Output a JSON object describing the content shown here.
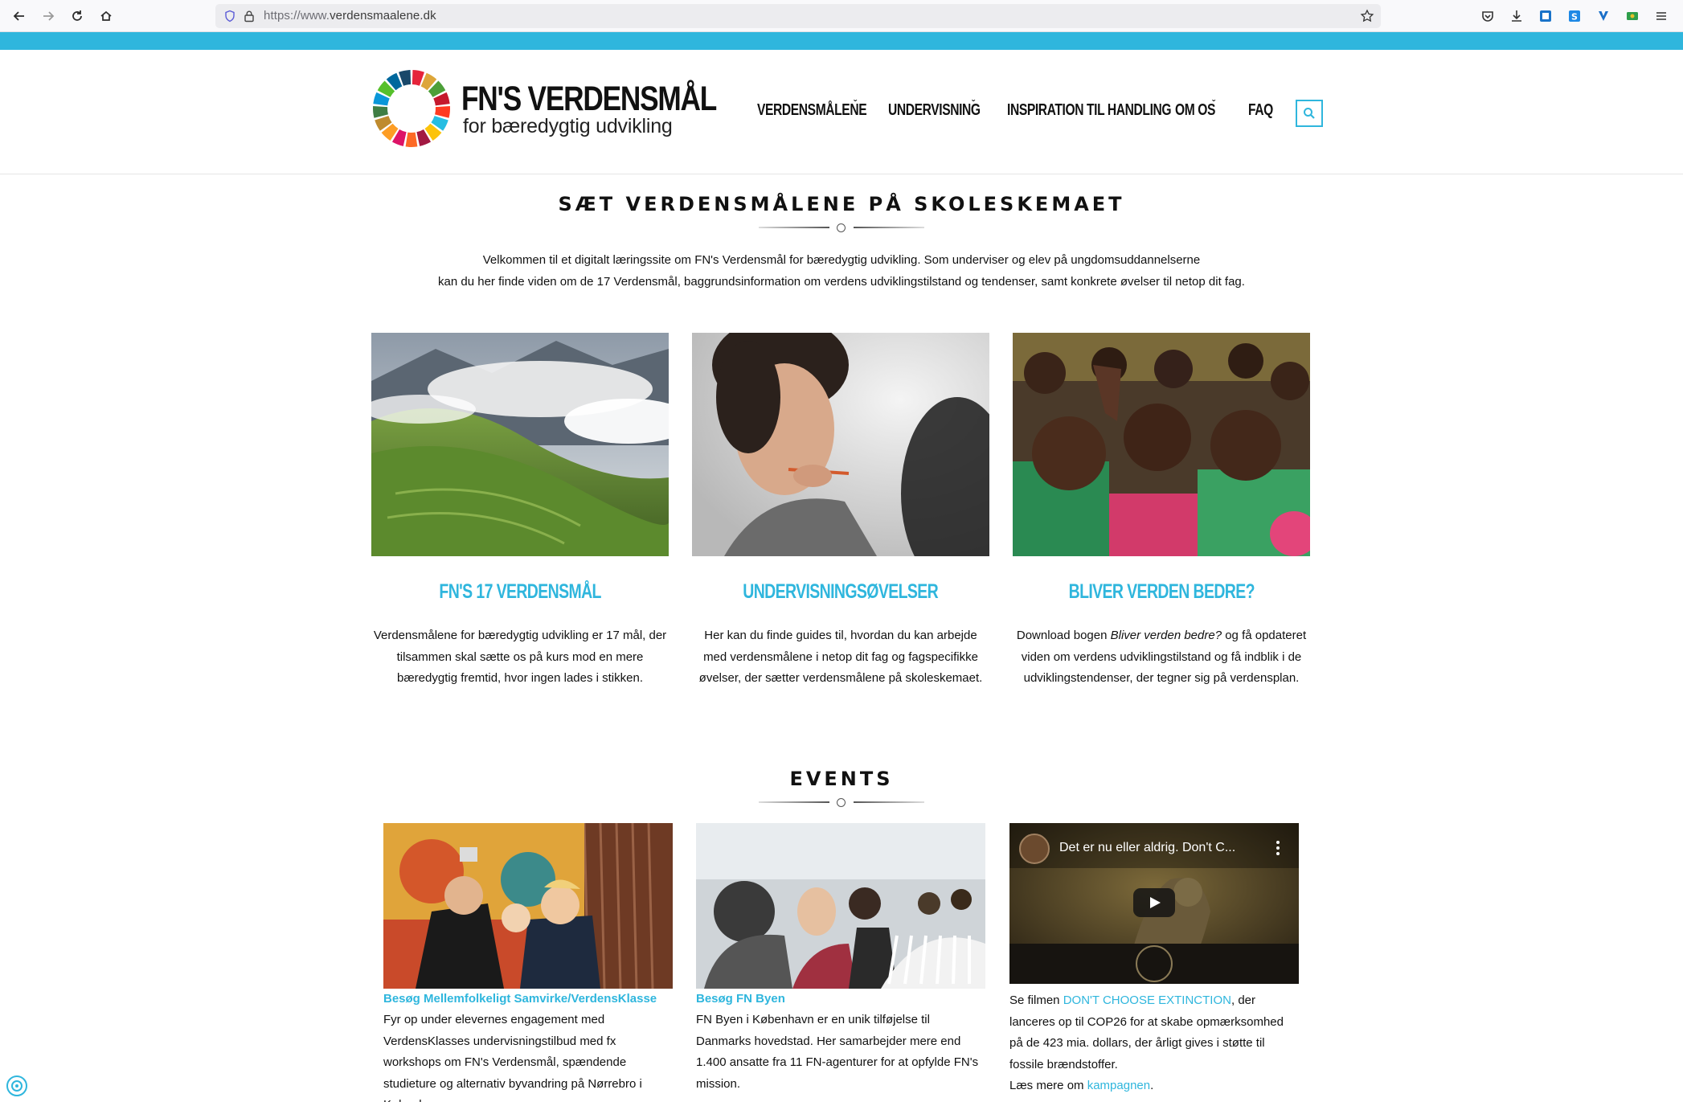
{
  "browser": {
    "url_prefix": "https://www.",
    "url_domain": "verdensmaalene.dk"
  },
  "colors": {
    "accent": "#2fb6dd",
    "text": "#111111"
  },
  "site": {
    "logo_title": "FN'S VERDENSMÅL",
    "logo_subtitle": "for bæredygtig udvikling",
    "nav": [
      {
        "label": "VERDENSMÅLENE",
        "has_dropdown": true
      },
      {
        "label": "UNDERVISNING",
        "has_dropdown": true
      },
      {
        "label": "INSPIRATION TIL HANDLING",
        "has_dropdown": false
      },
      {
        "label": "OM OS",
        "has_dropdown": true
      },
      {
        "label": "FAQ",
        "has_dropdown": false
      }
    ]
  },
  "hero": {
    "title": "SÆT VERDENSMÅLENE PÅ SKOLESKEMAET",
    "intro_line1": "Velkommen til et digitalt læringssite om FN's Verdensmål for bæredygtig udvikling. Som underviser og elev på ungdomsuddannelserne",
    "intro_line2": "kan du her finde viden om de 17 Verdensmål, baggrundsinformation om verdens udviklingstilstand og tendenser, samt konkrete øvelser til netop dit fag."
  },
  "cards": [
    {
      "title": "FN'S 17 VERDENSMÅL",
      "text": "Verdensmålene for bæredygtig udvikling er 17 mål, der tilsammen skal sætte os på kurs mod en mere bæredygtig fremtid, hvor ingen lades i stikken."
    },
    {
      "title": "UNDERVISNINGSØVELSER",
      "text": "Her kan du finde guides til, hvordan du kan arbejde med verdensmålene i netop dit fag og fagspecifikke øvelser, der sætter verdensmålene på skoleskemaet."
    },
    {
      "title": "BLIVER VERDEN BEDRE?",
      "text_pre": "Download bogen ",
      "text_em": "Bliver verden bedre?",
      "text_post": " og få opdateret viden om verdens udviklingstilstand og få indblik i de udviklingstendenser, der tegner sig på verdensplan."
    }
  ],
  "events": {
    "title": "EVENTS",
    "items": [
      {
        "link": "Besøg Mellemfolkeligt Samvirke/VerdensKlasse",
        "text": "Fyr op under elevernes engagement med VerdensKlasses undervisningstilbud med fx workshops om FN's Verdensmål, spændende studieture og alternativ byvandring på Nørrebro i København."
      },
      {
        "link": "Besøg FN Byen",
        "text": "FN Byen i København er en unik tilføjelse til Danmarks hovedstad. Her samarbejder mere end 1.400 ansatte fra 11 FN-agenturer for at opfylde FN's mission."
      },
      {
        "video_title": "Det er nu eller aldrig. Don't C...",
        "text_pre": "Se filmen ",
        "text_link": "DON'T CHOOSE EXTINCTION",
        "text_mid": ", der lanceres op til COP26 for at skabe opmærksomhed på de 423 mia. dollars, der årligt gives i støtte til fossile brændstoffer.",
        "text_pre2": "Læs mere om ",
        "text_link2": "kampagnen",
        "text_post2": "."
      }
    ]
  }
}
